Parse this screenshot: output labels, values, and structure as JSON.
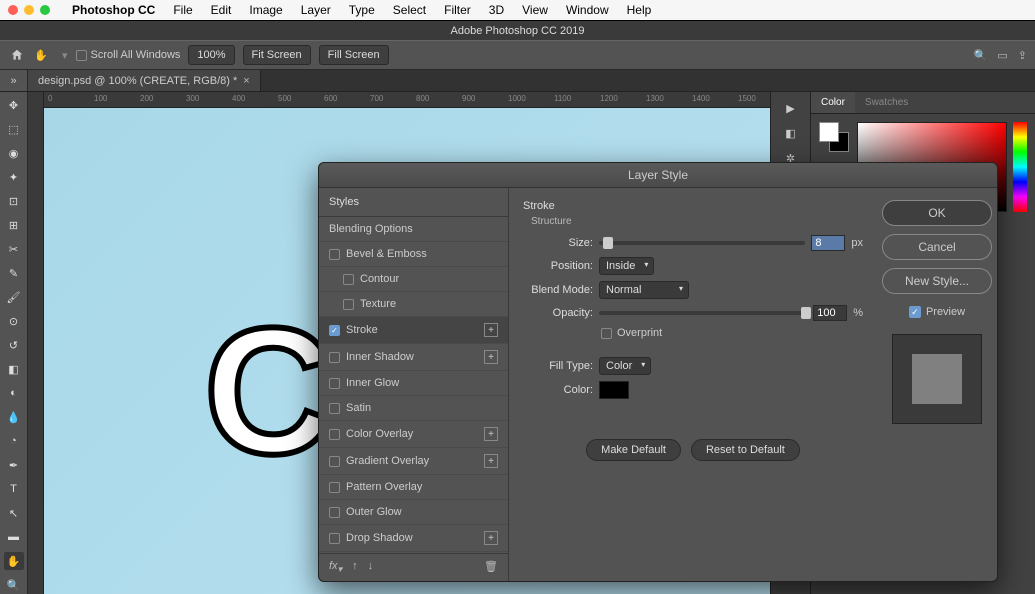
{
  "mac_menu": {
    "app": "Photoshop CC",
    "items": [
      "File",
      "Edit",
      "Image",
      "Layer",
      "Type",
      "Select",
      "Filter",
      "3D",
      "View",
      "Window",
      "Help"
    ]
  },
  "app_title": "Adobe Photoshop CC 2019",
  "option_bar": {
    "scroll_all": "Scroll All Windows",
    "zoom": "100%",
    "fit": "Fit Screen",
    "fill": "Fill Screen"
  },
  "doc_tab": "design.psd @ 100% (CREATE, RGB/8) *",
  "ruler_marks": [
    0,
    100,
    200,
    300,
    400,
    500,
    600,
    700,
    800,
    900,
    1000,
    1100,
    1200,
    1300,
    1400,
    1500
  ],
  "canvas_text": "CR",
  "panel_tabs": {
    "color": "Color",
    "swatches": "Swatches"
  },
  "dialog": {
    "title": "Layer Style",
    "styles_header": "Styles",
    "blending": "Blending Options",
    "rows": [
      {
        "label": "Bevel & Emboss",
        "checked": false,
        "plus": false
      },
      {
        "label": "Contour",
        "checked": false,
        "indent": true
      },
      {
        "label": "Texture",
        "checked": false,
        "indent": true
      },
      {
        "label": "Stroke",
        "checked": true,
        "plus": true,
        "selected": true
      },
      {
        "label": "Inner Shadow",
        "checked": false,
        "plus": true
      },
      {
        "label": "Inner Glow",
        "checked": false
      },
      {
        "label": "Satin",
        "checked": false
      },
      {
        "label": "Color Overlay",
        "checked": false,
        "plus": true
      },
      {
        "label": "Gradient Overlay",
        "checked": false,
        "plus": true
      },
      {
        "label": "Pattern Overlay",
        "checked": false
      },
      {
        "label": "Outer Glow",
        "checked": false
      },
      {
        "label": "Drop Shadow",
        "checked": false,
        "plus": true
      }
    ],
    "stroke": {
      "title": "Stroke",
      "structure": "Structure",
      "size_label": "Size:",
      "size_value": "8",
      "size_unit": "px",
      "position_label": "Position:",
      "position_value": "Inside",
      "blend_label": "Blend Mode:",
      "blend_value": "Normal",
      "opacity_label": "Opacity:",
      "opacity_value": "100",
      "opacity_unit": "%",
      "overprint": "Overprint",
      "filltype_label": "Fill Type:",
      "filltype_value": "Color",
      "color_label": "Color:"
    },
    "buttons": {
      "make_default": "Make Default",
      "reset": "Reset to Default",
      "ok": "OK",
      "cancel": "Cancel",
      "newstyle": "New Style...",
      "preview": "Preview"
    }
  }
}
